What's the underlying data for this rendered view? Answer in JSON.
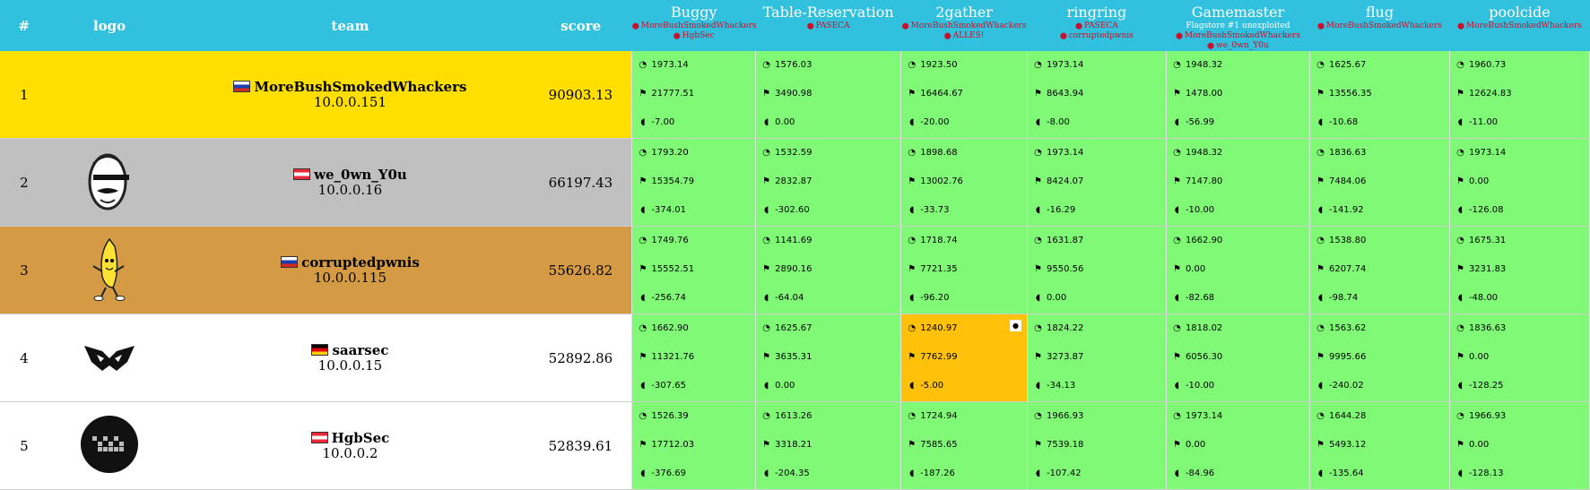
{
  "header": {
    "rank": "#",
    "logo": "logo",
    "team": "team",
    "score": "score"
  },
  "services": [
    {
      "name": "Buggy",
      "note": "",
      "first_bloods": [
        "MoreBushSmokedWhackers",
        "HgbSec"
      ]
    },
    {
      "name": "Table-Reservation",
      "note": "",
      "first_bloods": [
        "PASECA"
      ]
    },
    {
      "name": "2gather",
      "note": "",
      "first_bloods": [
        "MoreBushSmokedWhackers",
        "ALLES!"
      ]
    },
    {
      "name": "ringring",
      "note": "",
      "first_bloods": [
        "PASECA",
        "corruptedpwnis"
      ]
    },
    {
      "name": "Gamemaster",
      "note": "Flagstore #1 unexploited",
      "first_bloods": [
        "MoreBushSmokedWhackers",
        "we_0wn_Y0u"
      ]
    },
    {
      "name": "flug",
      "note": "",
      "first_bloods": [
        "MoreBushSmokedWhackers"
      ]
    },
    {
      "name": "poolcide",
      "note": "",
      "first_bloods": [
        "MoreBushSmokedWhackers"
      ]
    }
  ],
  "icons": {
    "first_blood": "blood-drop-icon",
    "sla": "gauge-icon",
    "offense": "flag-icon",
    "defense": "shield-icon"
  },
  "colors": {
    "header": "#31c0dd",
    "rank1": "#ffdf00",
    "rank2": "#c0c0c0",
    "rank3": "#d49a44",
    "service_ok": "#80fa76",
    "service_warn": "#ffc10a",
    "first_blood": "#c8102e"
  },
  "rows": [
    {
      "rank": "1",
      "logo": "none",
      "team": "MoreBushSmokedWhackers",
      "flag": "ru",
      "ip": "10.0.0.151",
      "score": "90903.13",
      "cells": [
        {
          "sla": "1973.14",
          "offense": "21777.51",
          "defense": "-7.00",
          "status": "ok"
        },
        {
          "sla": "1576.03",
          "offense": "3490.98",
          "defense": "0.00",
          "status": "ok"
        },
        {
          "sla": "1923.50",
          "offense": "16464.67",
          "defense": "-20.00",
          "status": "ok"
        },
        {
          "sla": "1973.14",
          "offense": "8643.94",
          "defense": "-8.00",
          "status": "ok"
        },
        {
          "sla": "1948.32",
          "offense": "1478.00",
          "defense": "-56.99",
          "status": "ok"
        },
        {
          "sla": "1625.67",
          "offense": "13556.35",
          "defense": "-10.68",
          "status": "ok"
        },
        {
          "sla": "1960.73",
          "offense": "12624.83",
          "defense": "-11.00",
          "status": "ok"
        }
      ]
    },
    {
      "rank": "2",
      "logo": "mustache-face",
      "team": "we_0wn_Y0u",
      "flag": "at",
      "ip": "10.0.0.16",
      "score": "66197.43",
      "cells": [
        {
          "sla": "1793.20",
          "offense": "15354.79",
          "defense": "-374.01",
          "status": "ok"
        },
        {
          "sla": "1532.59",
          "offense": "2832.87",
          "defense": "-302.60",
          "status": "ok"
        },
        {
          "sla": "1898.68",
          "offense": "13002.76",
          "defense": "-33.73",
          "status": "ok"
        },
        {
          "sla": "1973.14",
          "offense": "8424.07",
          "defense": "-16.29",
          "status": "ok"
        },
        {
          "sla": "1948.32",
          "offense": "7147.80",
          "defense": "-10.00",
          "status": "ok"
        },
        {
          "sla": "1836.63",
          "offense": "7484.06",
          "defense": "-141.92",
          "status": "ok"
        },
        {
          "sla": "1973.14",
          "offense": "0.00",
          "defense": "-126.08",
          "status": "ok"
        }
      ]
    },
    {
      "rank": "3",
      "logo": "dancing-banana",
      "team": "corruptedpwnis",
      "flag": "ru",
      "ip": "10.0.0.115",
      "score": "55626.82",
      "cells": [
        {
          "sla": "1749.76",
          "offense": "15552.51",
          "defense": "-256.74",
          "status": "ok"
        },
        {
          "sla": "1141.69",
          "offense": "2890.16",
          "defense": "-64.04",
          "status": "ok"
        },
        {
          "sla": "1718.74",
          "offense": "7721.35",
          "defense": "-96.20",
          "status": "ok"
        },
        {
          "sla": "1631.87",
          "offense": "9550.56",
          "defense": "0.00",
          "status": "ok"
        },
        {
          "sla": "1662.90",
          "offense": "0.00",
          "defense": "-82.68",
          "status": "ok"
        },
        {
          "sla": "1538.80",
          "offense": "6207.74",
          "defense": "-98.74",
          "status": "ok"
        },
        {
          "sla": "1675.31",
          "offense": "3231.83",
          "defense": "-48.00",
          "status": "ok"
        }
      ]
    },
    {
      "rank": "4",
      "logo": "saarsec-mask",
      "team": "saarsec",
      "flag": "de",
      "ip": "10.0.0.15",
      "score": "52892.86",
      "cells": [
        {
          "sla": "1662.90",
          "offense": "11321.76",
          "defense": "-307.65",
          "status": "ok"
        },
        {
          "sla": "1625.67",
          "offense": "3635.31",
          "defense": "0.00",
          "status": "ok"
        },
        {
          "sla": "1240.97",
          "offense": "7762.99",
          "defense": "-5.00",
          "status": "warn"
        },
        {
          "sla": "1824.22",
          "offense": "3273.87",
          "defense": "-34.13",
          "status": "ok"
        },
        {
          "sla": "1818.02",
          "offense": "6056.30",
          "defense": "-10.00",
          "status": "ok"
        },
        {
          "sla": "1563.62",
          "offense": "9995.66",
          "defense": "-240.02",
          "status": "ok"
        },
        {
          "sla": "1836.63",
          "offense": "0.00",
          "defense": "-128.25",
          "status": "ok"
        }
      ]
    },
    {
      "rank": "5",
      "logo": "hgbsec-circle",
      "team": "HgbSec",
      "flag": "at",
      "ip": "10.0.0.2",
      "score": "52839.61",
      "cells": [
        {
          "sla": "1526.39",
          "offense": "17712.03",
          "defense": "-376.69",
          "status": "ok"
        },
        {
          "sla": "1613.26",
          "offense": "3318.21",
          "defense": "-204.35",
          "status": "ok"
        },
        {
          "sla": "1724.94",
          "offense": "7585.65",
          "defense": "-187.26",
          "status": "ok"
        },
        {
          "sla": "1966.93",
          "offense": "7539.18",
          "defense": "-107.42",
          "status": "ok"
        },
        {
          "sla": "1973.14",
          "offense": "0.00",
          "defense": "-84.96",
          "status": "ok"
        },
        {
          "sla": "1644.28",
          "offense": "5493.12",
          "defense": "-135.64",
          "status": "ok"
        },
        {
          "sla": "1966.93",
          "offense": "0.00",
          "defense": "-128.13",
          "status": "ok"
        }
      ]
    }
  ]
}
